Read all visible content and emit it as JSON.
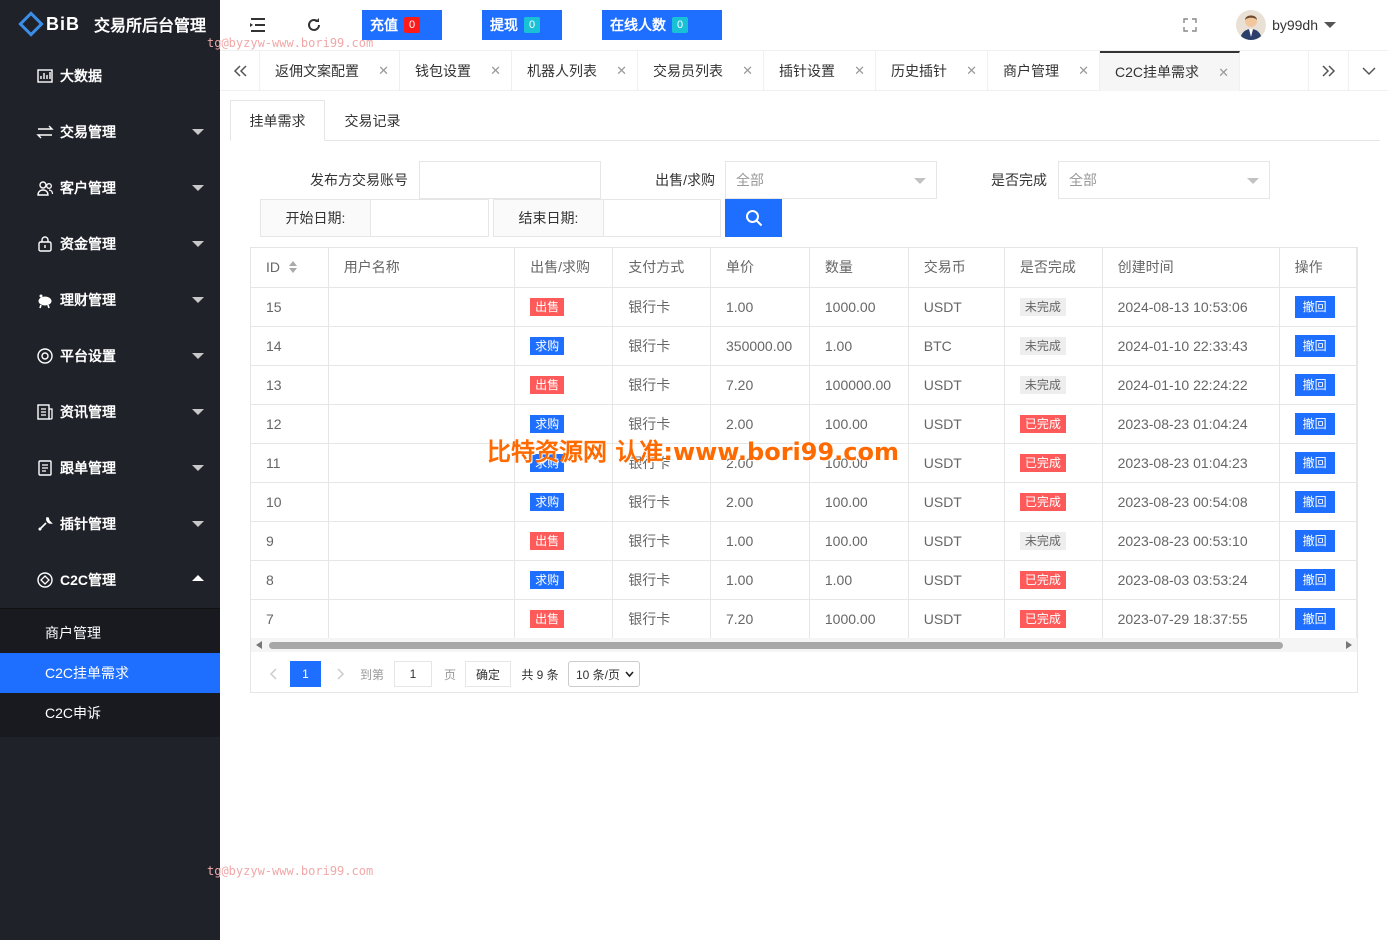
{
  "app": {
    "brand": "BiB",
    "title": "交易所后台管理"
  },
  "sidebar": {
    "items": [
      {
        "label": "大数据",
        "icon": "chart-icon",
        "has_caret": false
      },
      {
        "label": "交易管理",
        "icon": "exchange-icon",
        "has_caret": true
      },
      {
        "label": "客户管理",
        "icon": "users-icon",
        "has_caret": true
      },
      {
        "label": "资金管理",
        "icon": "wallet-lock-icon",
        "has_caret": true
      },
      {
        "label": "理财管理",
        "icon": "piggy-bank-icon",
        "has_caret": true
      },
      {
        "label": "平台设置",
        "icon": "settings-circle-icon",
        "has_caret": true
      },
      {
        "label": "资讯管理",
        "icon": "news-icon",
        "has_caret": true
      },
      {
        "label": "跟单管理",
        "icon": "document-icon",
        "has_caret": true
      },
      {
        "label": "插针管理",
        "icon": "wrench-icon",
        "has_caret": true
      },
      {
        "label": "C2C管理",
        "icon": "c2c-icon",
        "has_caret": true,
        "expanded": true
      }
    ],
    "submenu": [
      {
        "label": "商户管理",
        "active": false
      },
      {
        "label": "C2C挂单需求",
        "active": true
      },
      {
        "label": "C2C申诉",
        "active": false
      }
    ]
  },
  "header": {
    "stats": [
      {
        "label": "充值",
        "count": "0",
        "badge_color": "#ff1a1a"
      },
      {
        "label": "提现",
        "count": "0",
        "badge_color": "#19c1d6"
      },
      {
        "label": "在线人数",
        "count": "0",
        "badge_color": "#19c1d6"
      }
    ],
    "username": "by99dh"
  },
  "watermark_text": "tg@byzyw-www.bori99.com",
  "tabs": [
    {
      "label": "返佣文案配置"
    },
    {
      "label": "钱包设置"
    },
    {
      "label": "机器人列表"
    },
    {
      "label": "交易员列表"
    },
    {
      "label": "插针设置"
    },
    {
      "label": "历史插针"
    },
    {
      "label": "商户管理"
    },
    {
      "label": "C2C挂单需求",
      "active": true
    }
  ],
  "subtabs": [
    {
      "label": "挂单需求",
      "active": true
    },
    {
      "label": "交易记录"
    }
  ],
  "filters": {
    "account_label": "发布方交易账号",
    "account_value": "",
    "type_label": "出售/求购",
    "type_value": "全部",
    "done_label": "是否完成",
    "done_value": "全部",
    "start_label": "开始日期:",
    "start_value": "",
    "end_label": "结束日期:",
    "end_value": ""
  },
  "table": {
    "headers": [
      "ID",
      "用户名称",
      "出售/求购",
      "支付方式",
      "单价",
      "数量",
      "交易币",
      "是否完成",
      "创建时间",
      "操作"
    ],
    "rows": [
      {
        "id": "15",
        "user": "",
        "type": "出售",
        "pay": "银行卡",
        "price": "1.00",
        "qty": "1000.00",
        "coin": "USDT",
        "done": "未完成",
        "time": "2024-08-13 10:53:06",
        "op": "撤回"
      },
      {
        "id": "14",
        "user": "",
        "type": "求购",
        "pay": "银行卡",
        "price": "350000.00",
        "qty": "1.00",
        "coin": "BTC",
        "done": "未完成",
        "time": "2024-01-10 22:33:43",
        "op": "撤回"
      },
      {
        "id": "13",
        "user": "",
        "type": "出售",
        "pay": "银行卡",
        "price": "7.20",
        "qty": "100000.00",
        "coin": "USDT",
        "done": "未完成",
        "time": "2024-01-10 22:24:22",
        "op": "撤回"
      },
      {
        "id": "12",
        "user": "",
        "type": "求购",
        "pay": "银行卡",
        "price": "2.00",
        "qty": "100.00",
        "coin": "USDT",
        "done": "已完成",
        "time": "2023-08-23 01:04:24",
        "op": "撤回"
      },
      {
        "id": "11",
        "user": "",
        "type": "求购",
        "pay": "银行卡",
        "price": "2.00",
        "qty": "100.00",
        "coin": "USDT",
        "done": "已完成",
        "time": "2023-08-23 01:04:23",
        "op": "撤回"
      },
      {
        "id": "10",
        "user": "",
        "type": "求购",
        "pay": "银行卡",
        "price": "2.00",
        "qty": "100.00",
        "coin": "USDT",
        "done": "已完成",
        "time": "2023-08-23 00:54:08",
        "op": "撤回"
      },
      {
        "id": "9",
        "user": "",
        "type": "出售",
        "pay": "银行卡",
        "price": "1.00",
        "qty": "100.00",
        "coin": "USDT",
        "done": "未完成",
        "time": "2023-08-23 00:53:10",
        "op": "撤回"
      },
      {
        "id": "8",
        "user": "",
        "type": "求购",
        "pay": "银行卡",
        "price": "1.00",
        "qty": "1.00",
        "coin": "USDT",
        "done": "已完成",
        "time": "2023-08-03 03:53:24",
        "op": "撤回"
      },
      {
        "id": "7",
        "user": "",
        "type": "出售",
        "pay": "银行卡",
        "price": "7.20",
        "qty": "1000.00",
        "coin": "USDT",
        "done": "已完成",
        "time": "2023-07-29 18:37:55",
        "op": "撤回"
      }
    ]
  },
  "pagination": {
    "current": "1",
    "goto_prefix": "到第",
    "goto_value": "1",
    "goto_suffix": "页",
    "confirm": "确定",
    "total": "共 9 条",
    "page_size": "10 条/页"
  },
  "overlay_watermark": "比特资源网 认准:www.bori99.com",
  "colors": {
    "primary": "#1e6fff",
    "sidebar_bg": "#20222a",
    "sell": "#ff5a5a",
    "done": "#ff5a5a"
  }
}
